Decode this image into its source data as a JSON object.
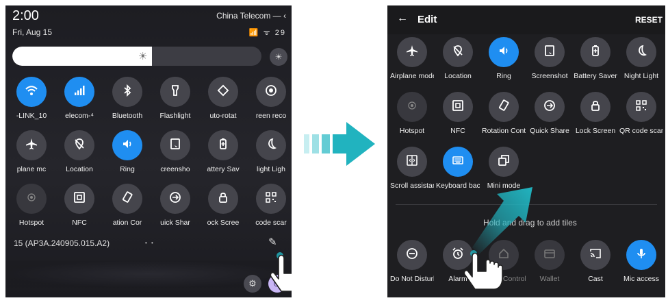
{
  "left": {
    "status": {
      "time": "2:00",
      "carrier": "China Telecom — ‹",
      "date": "Fri, Aug 15",
      "icons": "📶 ᯤ 29"
    },
    "tiles": [
      {
        "label": "-LINK_10",
        "icon": "wifi-icon",
        "state": "on"
      },
      {
        "label": "elecom-⁴",
        "icon": "signal-icon",
        "state": "on"
      },
      {
        "label": "Bluetooth",
        "icon": "bluetooth-icon",
        "state": "off"
      },
      {
        "label": "Flashlight",
        "icon": "flashlight-icon",
        "state": "off"
      },
      {
        "label": "uto-rotat",
        "icon": "rotate-icon",
        "state": "off"
      },
      {
        "label": "reen reco",
        "icon": "screen-record-icon",
        "state": "off"
      },
      {
        "label": "plane mc",
        "icon": "airplane-icon",
        "state": "off"
      },
      {
        "label": "Location",
        "icon": "location-off-icon",
        "state": "off"
      },
      {
        "label": "Ring",
        "icon": "ring-icon",
        "state": "on"
      },
      {
        "label": "creensho",
        "icon": "screenshot-icon",
        "state": "off"
      },
      {
        "label": "attery Sav",
        "icon": "battery-saver-icon",
        "state": "off"
      },
      {
        "label": "light Ligh",
        "icon": "night-light-icon",
        "state": "off"
      },
      {
        "label": "Hotspot",
        "icon": "hotspot-icon",
        "state": "dim"
      },
      {
        "label": "NFC",
        "icon": "nfc-icon",
        "state": "off"
      },
      {
        "label": "ation Cor",
        "icon": "rotation-control-icon",
        "state": "off"
      },
      {
        "label": "uick Shar",
        "icon": "quick-share-icon",
        "state": "off"
      },
      {
        "label": "ock Scree",
        "icon": "lock-screen-icon",
        "state": "off"
      },
      {
        "label": "code scar",
        "icon": "qr-code-icon",
        "state": "off"
      }
    ],
    "build": "15 (AP3A.240905.015.A2)",
    "page_dots": "• •",
    "brightness_level": 0.56
  },
  "right": {
    "header": {
      "back": "←",
      "title": "Edit",
      "reset": "RESET"
    },
    "active_tiles": [
      {
        "label": "Airplane mode",
        "icon": "airplane-icon",
        "state": "off"
      },
      {
        "label": "Location",
        "icon": "location-off-icon",
        "state": "off"
      },
      {
        "label": "Ring",
        "icon": "ring-icon",
        "state": "on"
      },
      {
        "label": "Screenshot",
        "icon": "screenshot-icon",
        "state": "off"
      },
      {
        "label": "Battery Saver",
        "icon": "battery-saver-icon",
        "state": "off"
      },
      {
        "label": "Night Light",
        "icon": "night-light-icon",
        "state": "off"
      },
      {
        "label": "Hotspot",
        "icon": "hotspot-icon",
        "state": "dim"
      },
      {
        "label": "NFC",
        "icon": "nfc-icon",
        "state": "off"
      },
      {
        "label": "Rotation Control",
        "icon": "rotation-control-icon",
        "state": "off"
      },
      {
        "label": "Quick Share",
        "icon": "quick-share-icon",
        "state": "off"
      },
      {
        "label": "Lock Screen",
        "icon": "lock-screen-icon",
        "state": "off"
      },
      {
        "label": "QR code scanner",
        "icon": "qr-code-icon",
        "state": "off"
      },
      {
        "label": "Scroll assistant",
        "icon": "scroll-assistant-icon",
        "state": "off"
      },
      {
        "label": "Keyboard backlight",
        "icon": "keyboard-backlight-icon",
        "state": "on"
      },
      {
        "label": "Mini mode",
        "icon": "mini-mode-icon",
        "state": "off"
      }
    ],
    "hint": "Hold and drag to add tiles",
    "available_tiles": [
      {
        "label": "Do Not Disturb",
        "icon": "do-not-disturb-icon",
        "state": "off"
      },
      {
        "label": "Alarm",
        "icon": "alarm-icon",
        "state": "off"
      },
      {
        "label": "Home Controls",
        "icon": "home-controls-icon",
        "state": "dim"
      },
      {
        "label": "Wallet",
        "icon": "wallet-icon",
        "state": "dim"
      },
      {
        "label": "Cast",
        "icon": "cast-icon",
        "state": "off"
      },
      {
        "label": "Mic access",
        "icon": "mic-icon",
        "state": "on"
      }
    ]
  },
  "colors": {
    "accent": "#1f8ef1",
    "arrow": "#21b3bf",
    "tile_off": "#45454c"
  }
}
